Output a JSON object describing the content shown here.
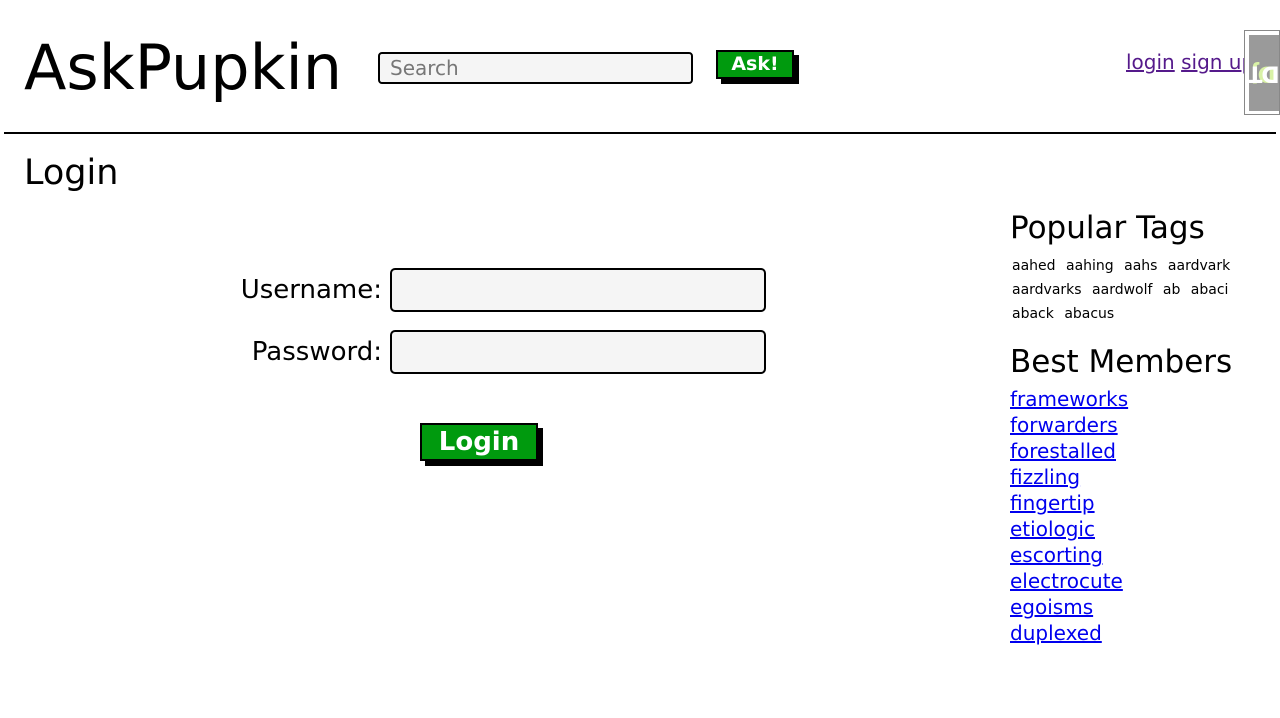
{
  "header": {
    "logo": "AskPupkin",
    "search_placeholder": "Search",
    "ask_label": "Ask!",
    "login_label": "login",
    "signup_label": "sign up",
    "debug_toolbar_label_dj": "Dj",
    "debug_toolbar_label_dt": "DT"
  },
  "main": {
    "title": "Login",
    "username_label": "Username:",
    "password_label": "Password:",
    "username_value": "",
    "password_value": "",
    "login_button": "Login"
  },
  "sidebar": {
    "tags_heading": "Popular Tags",
    "tags": [
      "aahed",
      "aahing",
      "aahs",
      "aardvark",
      "aardvarks",
      "aardwolf",
      "ab",
      "abaci",
      "aback",
      "abacus"
    ],
    "members_heading": "Best Members",
    "members": [
      "frameworks",
      "forwarders",
      "forestalled",
      "fizzling",
      "fingertip",
      "etiologic",
      "escorting",
      "electrocute",
      "egoisms",
      "duplexed"
    ]
  },
  "colors": {
    "button_green": "#009a0e",
    "link_visited": "#551a8b",
    "link": "#0000ee",
    "debug_toolbar_bg": "#9a9a9a"
  }
}
